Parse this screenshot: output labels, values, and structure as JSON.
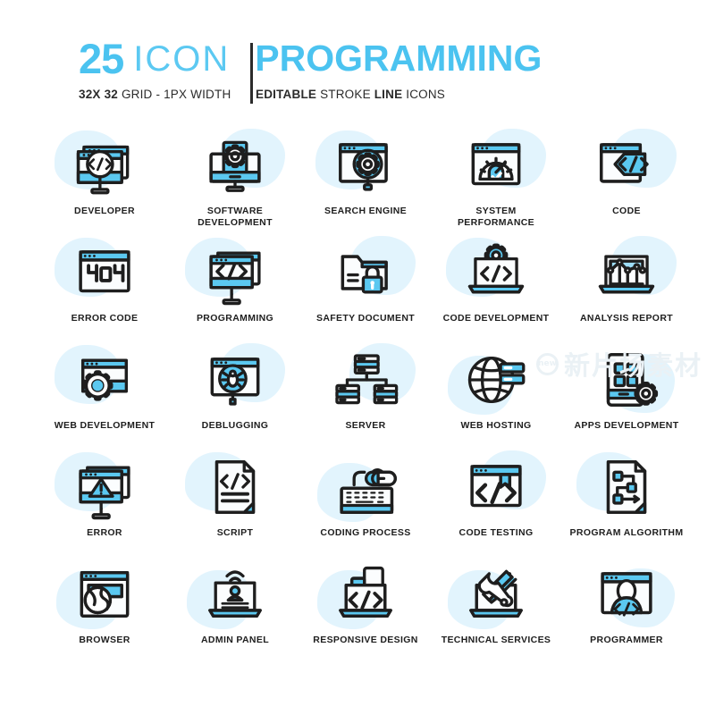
{
  "header": {
    "count": "25",
    "icon_word": "ICON",
    "title": "PROGRAMMING",
    "sub_left_bold": "32X 32",
    "sub_left_rest": "GRID - 1PX WIDTH",
    "sub_right_bold": "EDITABLE",
    "sub_right_rest": "STROKE",
    "sub_right_bold2": "LINE",
    "sub_right_rest2": "ICONS"
  },
  "colors": {
    "accent": "#5BC8F0",
    "accent_light": "#9EDDF7",
    "blob": "#E2F4FD",
    "stroke": "#1E1E1E",
    "title_blue": "#4BC3F0",
    "panel": "#FBFDFE"
  },
  "watermark": {
    "badge": "new",
    "text": "新片场素材"
  },
  "icons": [
    {
      "id": "developer",
      "label": "DEVELOPER",
      "icon_name": "monitor-magnifier-code-icon",
      "blob": "tl"
    },
    {
      "id": "software-development",
      "label": "SOFTWARE\nDEVELOPMENT",
      "icon_name": "monitor-gear-page-icon",
      "blob": "tr"
    },
    {
      "id": "search-engine",
      "label": "SEARCH ENGINE",
      "icon_name": "browser-magnifier-gear-icon",
      "blob": "tl"
    },
    {
      "id": "system-performance",
      "label": "SYSTEM\nPERFORMANCE",
      "icon_name": "browser-speed-gauge-icon",
      "blob": "tr"
    },
    {
      "id": "code",
      "label": "CODE",
      "icon_name": "browser-code-tag-icon",
      "blob": "tr"
    },
    {
      "id": "error-code",
      "label": "ERROR CODE",
      "icon_name": "browser-404-icon",
      "blob": "tl"
    },
    {
      "id": "programming",
      "label": "PROGRAMMING",
      "icon_name": "monitor-code-brackets-icon",
      "blob": "tl"
    },
    {
      "id": "safety-document",
      "label": "SAFETY DOCUMENT",
      "icon_name": "folder-padlock-icon",
      "blob": "tr"
    },
    {
      "id": "code-development",
      "label": "CODE DEVELOPMENT",
      "icon_name": "laptop-gear-code-icon",
      "blob": "tl"
    },
    {
      "id": "analysis-report",
      "label": "ANALYSIS REPORT",
      "icon_name": "laptop-line-chart-icon",
      "blob": "tr"
    },
    {
      "id": "web-development",
      "label": "WEB DEVELOPMENT",
      "icon_name": "browser-gear-icon",
      "blob": "tl"
    },
    {
      "id": "deblugging",
      "label": "DEBLUGGING",
      "icon_name": "browser-magnifier-bug-icon",
      "blob": "tr"
    },
    {
      "id": "server",
      "label": "SERVER",
      "icon_name": "server-tree-icon",
      "blob": "tr"
    },
    {
      "id": "web-hosting",
      "label": "WEB HOSTING",
      "icon_name": "globe-server-icon",
      "blob": "bl"
    },
    {
      "id": "apps-development",
      "label": "APPS DEVELOPMENT",
      "icon_name": "smartphone-grid-gear-icon",
      "blob": "br"
    },
    {
      "id": "error",
      "label": "ERROR",
      "icon_name": "monitor-warning-triangle-icon",
      "blob": "tl"
    },
    {
      "id": "script",
      "label": "SCRIPT",
      "icon_name": "document-code-lines-icon",
      "blob": "tl"
    },
    {
      "id": "coding-process",
      "label": "CODING PROCESS",
      "icon_name": "keyboard-mouse-icon",
      "blob": "bl"
    },
    {
      "id": "code-testing",
      "label": "CODE TESTING",
      "icon_name": "browser-bookmark-code-icon",
      "blob": "tr"
    },
    {
      "id": "program-algorithm",
      "label": "PROGRAM ALGORITHM",
      "icon_name": "document-flowchart-icon",
      "blob": "tl"
    },
    {
      "id": "browser",
      "label": "BROWSER",
      "icon_name": "browser-globe-icon",
      "blob": "bl"
    },
    {
      "id": "admin-panel",
      "label": "ADMIN PANEL",
      "icon_name": "laptop-user-wifi-icon",
      "blob": "bl"
    },
    {
      "id": "responsive-design",
      "label": "RESPONSIVE DESIGN",
      "icon_name": "laptop-tablet-phone-code-icon",
      "blob": "bl"
    },
    {
      "id": "technical-services",
      "label": "TECHNICAL SERVICES",
      "icon_name": "laptop-wrench-screwdriver-icon",
      "blob": "bl"
    },
    {
      "id": "programmer",
      "label": "PROGRAMMER",
      "icon_name": "browser-person-code-icon",
      "blob": "br"
    }
  ]
}
